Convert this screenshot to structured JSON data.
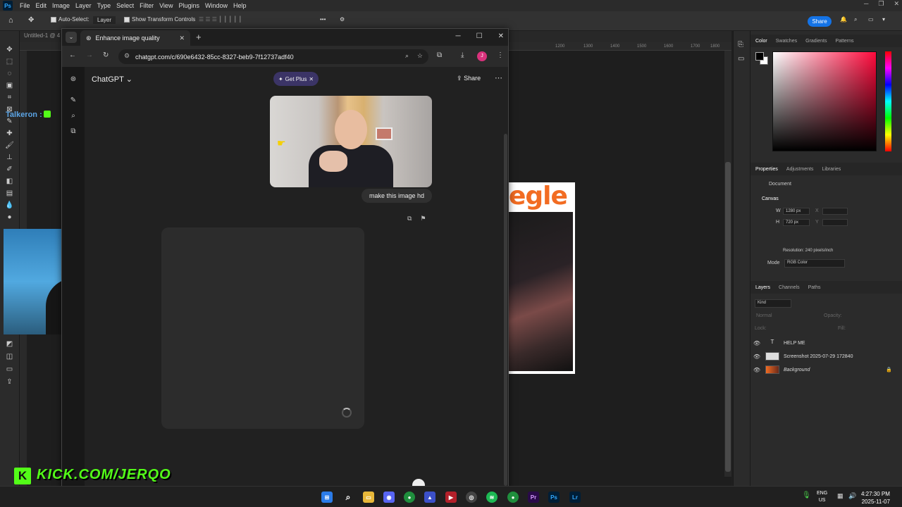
{
  "ps": {
    "logo": "Ps",
    "menu": [
      "File",
      "Edit",
      "Image",
      "Layer",
      "Type",
      "Select",
      "Filter",
      "View",
      "Plugins",
      "Window",
      "Help"
    ],
    "options": {
      "auto_select": "Auto-Select:",
      "layer_select": "Layer",
      "show_transform": "Show Transform Controls"
    },
    "share_label": "Share",
    "doc_tab": "Untitled-1 @ 4",
    "ruler_ticks": [
      "1200",
      "1300",
      "1400",
      "1500",
      "1600",
      "1700",
      "1800"
    ],
    "panels": {
      "color_tabs": [
        "Color",
        "Swatches",
        "Gradients",
        "Patterns"
      ],
      "props_tabs": [
        "Properties",
        "Adjustments",
        "Libraries"
      ],
      "document_label": "Document",
      "canvas_label": "Canvas",
      "w_label": "W",
      "w_value": "1280 px",
      "h_label": "H",
      "h_value": "720 px",
      "x_label": "X",
      "y_label": "Y",
      "resolution": "Resolution: 240 pixels/inch",
      "mode_label": "Mode",
      "mode_value": "RGB Color",
      "layers_tabs": [
        "Layers",
        "Channels",
        "Paths"
      ],
      "kind_label": "Kind",
      "normal_label": "Normal",
      "opacity_label": "Opacity:",
      "lock_label": "Lock:",
      "fill_label": "Fill:"
    },
    "layers": [
      {
        "name": "HELP ME",
        "type": "text"
      },
      {
        "name": "Screenshot 2025-07-29 172840",
        "type": "image"
      },
      {
        "name": "Background",
        "type": "image"
      }
    ],
    "canvas_image_text": "egle"
  },
  "browser": {
    "tab_title": "Enhance image quality",
    "url": "chatgpt.com/c/690e6432-85cc-8327-beb9-7f12737adf40",
    "avatar_letter": "J"
  },
  "chatgpt": {
    "title": "ChatGPT",
    "get_plus": "Get Plus",
    "share": "Share",
    "user_message": "make this image hd"
  },
  "stream": {
    "streamer": "Talkeron :",
    "kick_logo": "K",
    "kick_url": "KICK.COM/JERQO"
  },
  "taskbar": {
    "lang_top": "ENG",
    "lang_bottom": "US",
    "time": "4:27:30 PM",
    "date": "2025-11-07",
    "apps": [
      "start",
      "search",
      "file-explorer",
      "discord",
      "chrome",
      "app-arc",
      "app-video",
      "app-obs",
      "spotify",
      "chrome-profile",
      "premiere",
      "photoshop",
      "lightroom"
    ],
    "app_labels": {
      "pr": "Pr",
      "ps": "Ps",
      "lr": "Lr"
    }
  }
}
